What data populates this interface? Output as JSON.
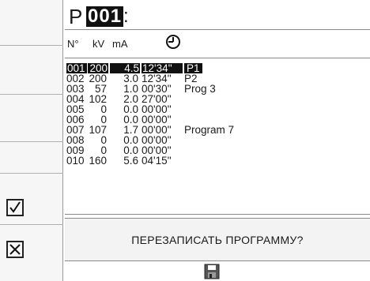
{
  "header": {
    "prefix": "P",
    "program_number": "001",
    "colon": ":"
  },
  "columns": {
    "number": "N°",
    "kv": "kV",
    "ma": "mA",
    "time_icon": "clock-icon"
  },
  "programs": [
    {
      "n": "001",
      "kv": "200",
      "ma": "4.5",
      "time": "12'34''",
      "name": "P1",
      "selected": true
    },
    {
      "n": "002",
      "kv": "200",
      "ma": "3.0",
      "time": "12'34''",
      "name": "P2"
    },
    {
      "n": "003",
      "kv": "57",
      "ma": "1.0",
      "time": "00'30''",
      "name": "Prog 3"
    },
    {
      "n": "004",
      "kv": "102",
      "ma": "2.0",
      "time": "27'00''",
      "name": ""
    },
    {
      "n": "005",
      "kv": "0",
      "ma": "0.0",
      "time": "00'00''",
      "name": ""
    },
    {
      "n": "006",
      "kv": "0",
      "ma": "0.0",
      "time": "00'00''",
      "name": ""
    },
    {
      "n": "007",
      "kv": "107",
      "ma": "1.7",
      "time": "00'00''",
      "name": "Program 7"
    },
    {
      "n": "008",
      "kv": "0",
      "ma": "0.0",
      "time": "00'00''",
      "name": ""
    },
    {
      "n": "009",
      "kv": "0",
      "ma": "0.0",
      "time": "00'00''",
      "name": ""
    },
    {
      "n": "010",
      "kv": "160",
      "ma": "5.6",
      "time": "04'15''",
      "name": ""
    }
  ],
  "dialog": {
    "message": "ПЕРЕЗАПИСАТЬ ПРОГРАММУ?"
  },
  "buttons": {
    "confirm_icon": "checkmark-icon",
    "cancel_icon": "close-icon",
    "save_icon": "floppy-disk-icon"
  }
}
